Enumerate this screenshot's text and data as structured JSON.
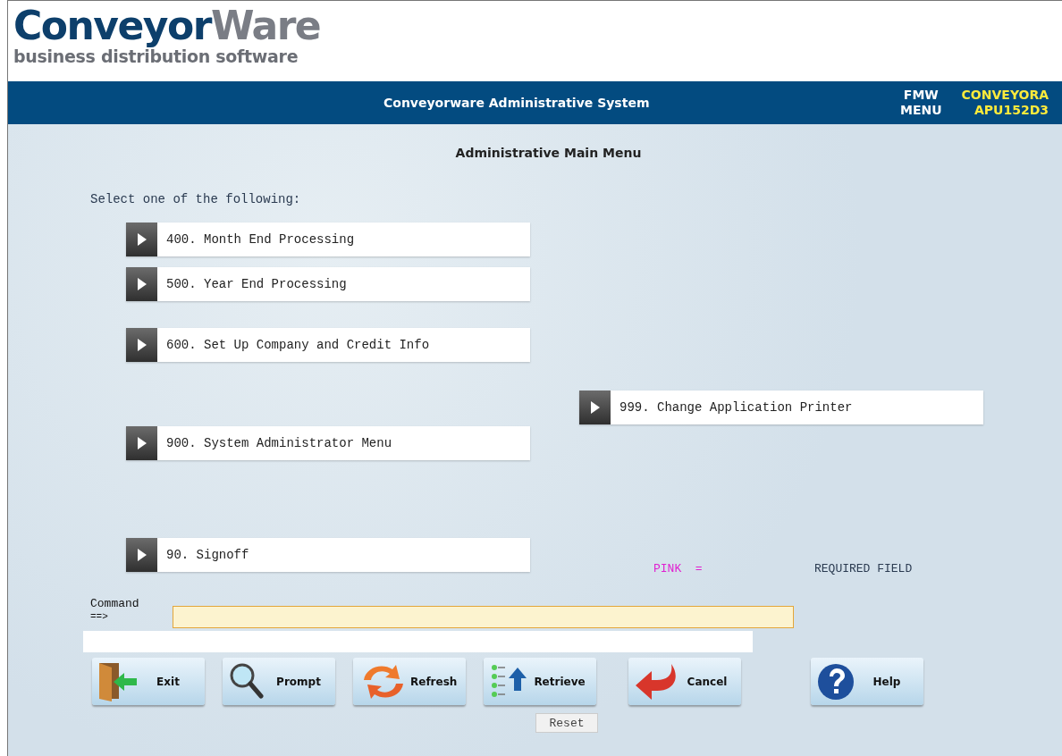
{
  "logo": {
    "brand_first": "Conveyor",
    "brand_second": "Ware",
    "tagline": "business distribution software"
  },
  "header": {
    "title": "Conveyorware Administrative System",
    "screen_lines": [
      "FMW",
      "MENU"
    ],
    "system_lines": [
      "CONVEYORA",
      "APU152D3"
    ]
  },
  "screen_title": "Administrative Main Menu",
  "instruction": "Select one of the following:",
  "menu_items": [
    {
      "label": "400. Month End Processing"
    },
    {
      "label": "500. Year End Processing"
    },
    {
      "label": "600. Set Up Company and Credit Info"
    },
    {
      "label": "999. Change Application Printer"
    },
    {
      "label": "900. System Administrator Menu"
    },
    {
      "label": "90. Signoff"
    }
  ],
  "legend": {
    "key": "PINK  =",
    "meaning": "REQUIRED FIELD"
  },
  "command": {
    "label": "Command",
    "arrow": "==>"
  },
  "buttons": [
    {
      "kind": "exit",
      "label": "Exit"
    },
    {
      "kind": "prompt",
      "label": "Prompt"
    },
    {
      "kind": "refresh",
      "label": "Refresh"
    },
    {
      "kind": "retrieve",
      "label": "Retrieve"
    },
    {
      "kind": "cancel",
      "label": "Cancel"
    },
    {
      "kind": "help",
      "label": "Help"
    }
  ],
  "reset_label": "Reset"
}
